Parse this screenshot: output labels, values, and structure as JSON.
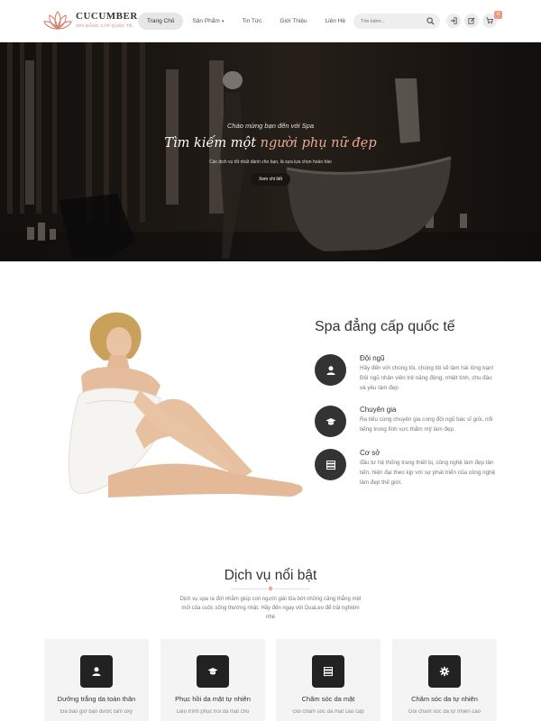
{
  "header": {
    "logo": {
      "name": "CUCUMBER",
      "tagline": "SPA ĐẲNG CẤP QUỐC TẾ"
    },
    "nav": [
      {
        "label": "Trang Chủ",
        "active": true,
        "has_dropdown": false
      },
      {
        "label": "Sản Phẩm",
        "active": false,
        "has_dropdown": true
      },
      {
        "label": "Tin Tức",
        "active": false,
        "has_dropdown": false
      },
      {
        "label": "Giới Thiệu",
        "active": false,
        "has_dropdown": false
      },
      {
        "label": "Liên Hệ",
        "active": false,
        "has_dropdown": false
      }
    ],
    "search": {
      "placeholder": "Tìm kiếm..."
    },
    "icons": [
      "search-icon",
      "login-icon",
      "register-icon",
      "cart-icon"
    ],
    "cart_count": "0"
  },
  "hero": {
    "welcome": "Chào mừng bạn đến với Spa",
    "title_prefix": "Tìm kiếm một",
    "title_accent": "người phụ nữ đẹp",
    "description": "Các dịch vụ tốt nhất dành cho bạn, là sựa lựa chọn hoàn hảo",
    "button": "Xem chi tiết"
  },
  "about": {
    "title": "Spa đẳng cấp quốc tế",
    "features": [
      {
        "icon": "user-icon",
        "title": "Đội ngũ",
        "text": "Hãy đến với chúng tôi, chúng tôi sẽ làm hài lòng bạn! Đội ngũ nhân viên trẻ năng động, nhiệt tình, chu đáo và yêu làm đẹp"
      },
      {
        "icon": "graduation-cap-icon",
        "title": "Chuyên gia",
        "text": "Ra tiếu cùng chuyên gia cùng đội ngũ bác sĩ giỏi, nổi tiếng trong lĩnh vực thẩm mỹ làm đẹp."
      },
      {
        "icon": "server-icon",
        "title": "Cơ sở",
        "text": "đầu tư hệ thống trang thiết bị, công nghệ làm đẹp tân tiến, hiện đại theo kịp với sự phát triển của công nghệ làm đẹp thế giới."
      }
    ]
  },
  "services": {
    "title": "Dịch vụ nổi bật",
    "description": "Dịch vụ spa ra đời nhằm giúp con người giải tỏa bớt những căng thẳng mệt mỏi của cuộc sống thường nhật. Hãy đến ngay với DuaLeo để trải nghiệm nhé",
    "cards": [
      {
        "icon": "user-icon",
        "title": "Dưỡng trắng da toàn thân",
        "text": "Đã bao giờ bạn được tắm oxy"
      },
      {
        "icon": "graduation-cap-icon",
        "title": "Phục hồi da mặt tự nhiên",
        "text": "Liệu trình phục hồi da mặt cho"
      },
      {
        "icon": "server-icon",
        "title": "Chăm sóc da mặt",
        "text": "Gói chăm sóc da mặt cao cấp"
      },
      {
        "icon": "gear-icon",
        "title": "Chăm sóc da tự nhiên",
        "text": "Gói chăm sóc da tự nhiên cao"
      }
    ]
  },
  "colors": {
    "accent": "#e8a892",
    "dark": "#333333",
    "card_bg": "#f4f4f4"
  }
}
